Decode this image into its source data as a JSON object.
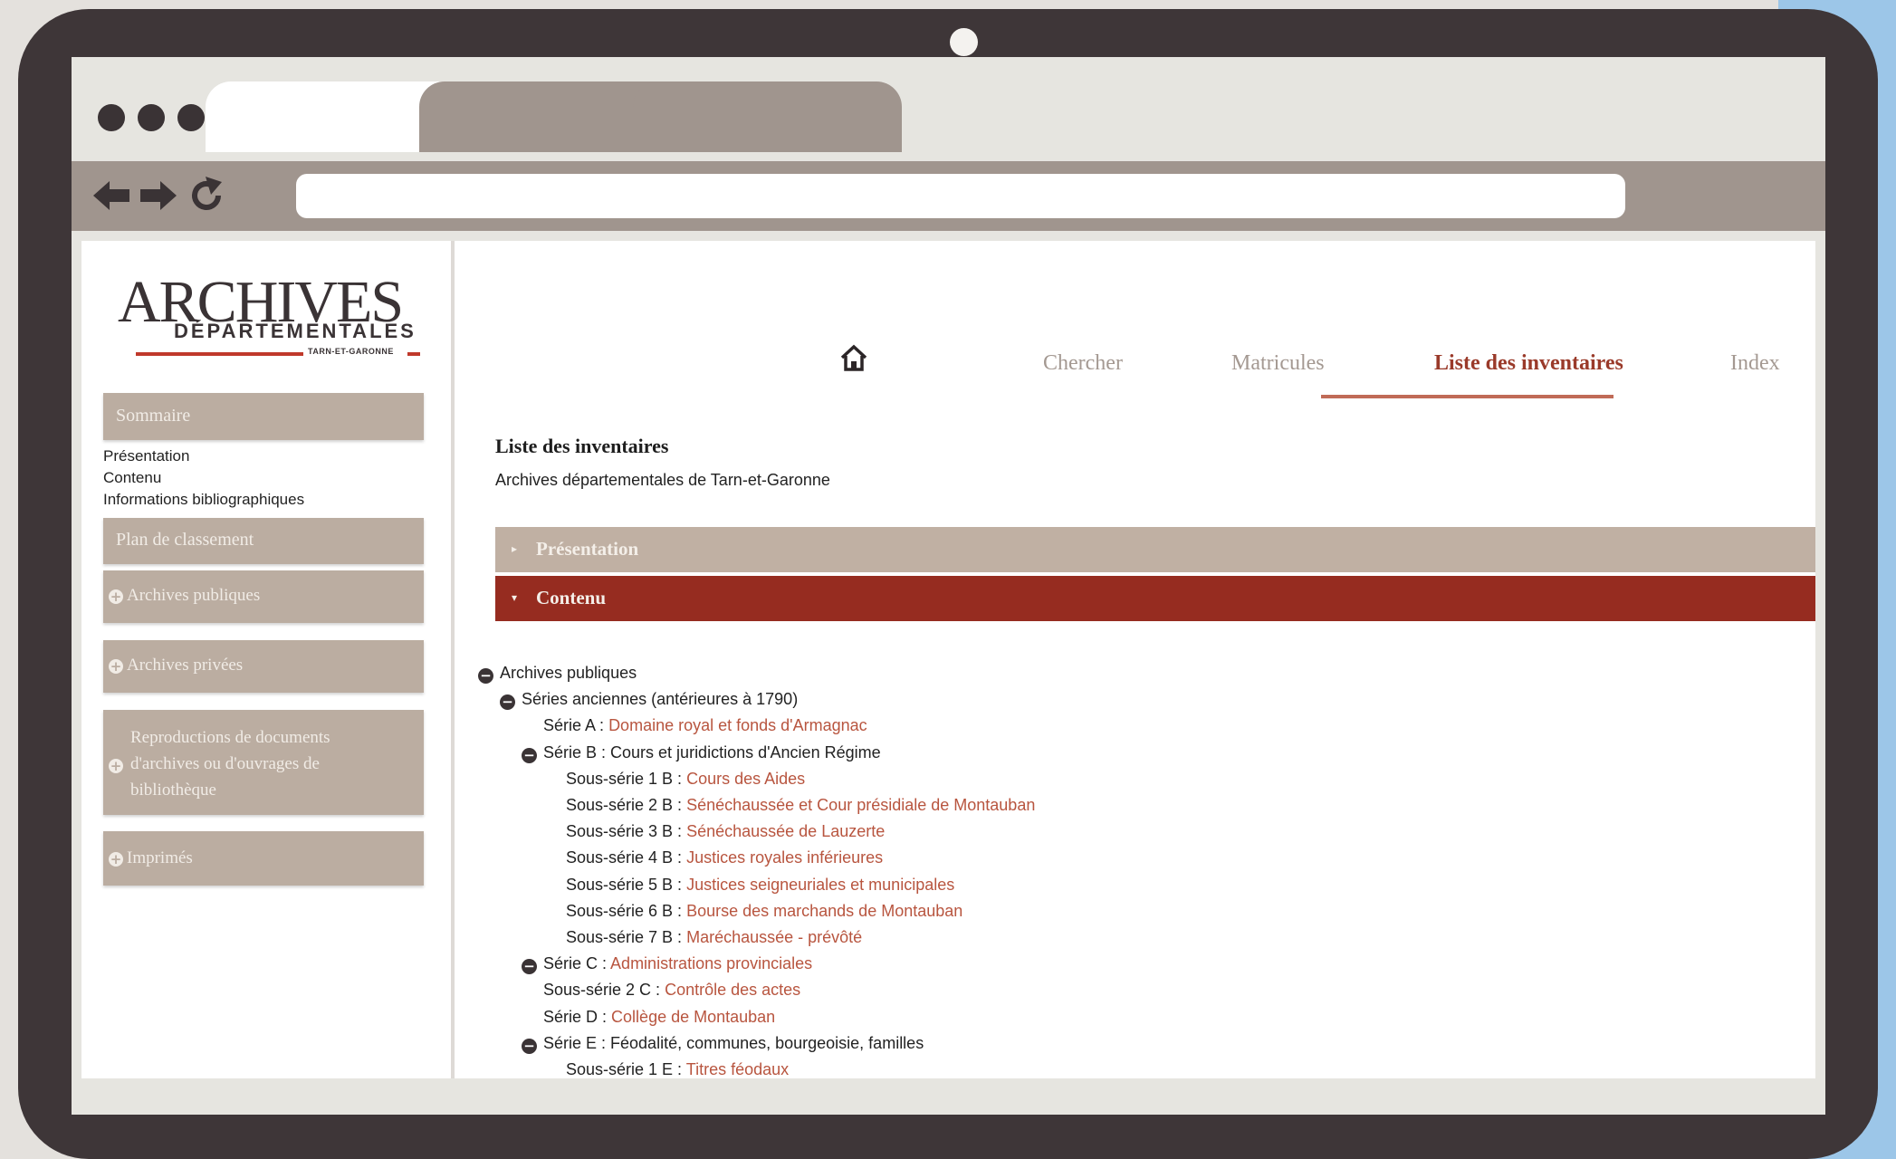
{
  "browser": {
    "tabs": [
      "",
      "",
      ""
    ]
  },
  "logo": {
    "main": "ARCHIVES",
    "sub": "DÉPARTEMENTALES",
    "small": "TARN-ET-GARONNE"
  },
  "sidebar": {
    "sommaire": "Sommaire",
    "links": [
      "Présentation",
      "Contenu",
      "Informations bibliographiques"
    ],
    "plan": "Plan de classement",
    "archives_publiques": "Archives publiques",
    "archives_privees": "Archives privées",
    "reproductions": [
      "Reproductions de documents",
      "d'archives ou d'ouvrages de",
      "bibliothèque"
    ],
    "imprimes": "Imprimés"
  },
  "menu": {
    "home_icon": "home-icon",
    "items": [
      "Chercher",
      "Matricules",
      "Liste des inventaires",
      "Index"
    ],
    "active": "Liste des inventaires"
  },
  "content": {
    "title": "Liste des inventaires",
    "subtitle": "Archives départementales de Tarn-et-Garonne",
    "presentation": "Présentation",
    "contenu": "Contenu",
    "tree": [
      {
        "prefix": "Archives publiques",
        "link": "",
        "level": 0,
        "minus": true
      },
      {
        "prefix": "Séries anciennes (antérieures à 1790)",
        "link": "",
        "level": 1,
        "minus": true
      },
      {
        "prefix": "Série A :",
        "link": "Domaine royal et fonds d'Armagnac",
        "level": 2,
        "minus": false
      },
      {
        "prefix": "Série B : Cours et juridictions d'Ancien Régime",
        "link": "",
        "level": 2,
        "minus": true
      },
      {
        "prefix": "Sous-série 1 B :",
        "link": "Cours des Aides",
        "level": 3,
        "minus": false
      },
      {
        "prefix": "Sous-série 2 B :",
        "link": "Sénéchaussée et Cour présidiale de Montauban",
        "level": 3,
        "minus": false
      },
      {
        "prefix": "Sous-série 3 B :",
        "link": "Sénéchaussée de Lauzerte",
        "level": 3,
        "minus": false
      },
      {
        "prefix": "Sous-série 4 B :",
        "link": "Justices royales inférieures",
        "level": 3,
        "minus": false
      },
      {
        "prefix": "Sous-série 5 B :",
        "link": "Justices seigneuriales et municipales",
        "level": 3,
        "minus": false
      },
      {
        "prefix": "Sous-série 6 B :",
        "link": "Bourse des marchands de Montauban",
        "level": 3,
        "minus": false
      },
      {
        "prefix": "Sous-série 7 B :",
        "link": "Maréchaussée - prévôté",
        "level": 3,
        "minus": false
      },
      {
        "prefix": "Série C :",
        "link": "Administrations provinciales",
        "level": 2,
        "minus": true
      },
      {
        "prefix": "Sous-série 2 C :",
        "link": "Contrôle des actes",
        "level": 2,
        "minus": false
      },
      {
        "prefix": "Série D :",
        "link": "Collège de Montauban",
        "level": 2,
        "minus": false
      },
      {
        "prefix": "Série E : Féodalité, communes, bourgeoisie, familles",
        "link": "",
        "level": 2,
        "minus": true
      },
      {
        "prefix": "Sous-série 1 E :",
        "link": "Titres féodaux",
        "level": 3,
        "minus": false
      }
    ]
  },
  "colors": {
    "frame": "#3e3638",
    "chrome": "#a0958e",
    "sidebar_box": "#bbada1",
    "presentation_bar": "#c0b0a3",
    "contenu_bar": "#962c20",
    "link": "#b8553f",
    "active_menu": "#9a3a2a"
  }
}
